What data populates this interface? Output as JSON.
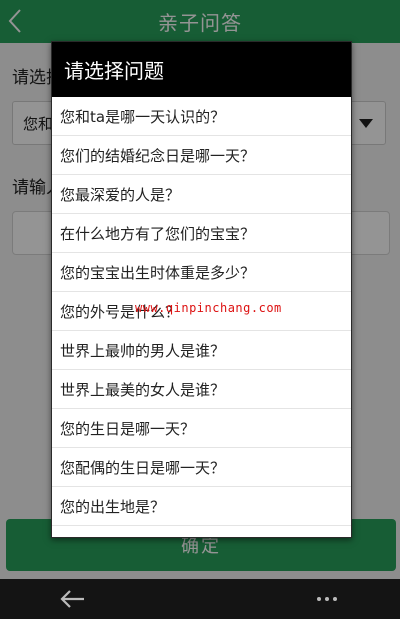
{
  "header": {
    "title": "亲子问答"
  },
  "form": {
    "label_question": "请选择您的问题：",
    "select_value": "您和ta是哪一天认识的？",
    "label_answer": "请输入答案：",
    "confirm_label": "确定"
  },
  "dialog": {
    "title": "请选择问题",
    "options": [
      "您和ta是哪一天认识的？",
      "您们的结婚纪念日是哪一天？",
      "您最深爱的人是？",
      "在什么地方有了您们的宝宝？",
      "您的宝宝出生时体重是多少？",
      "您的外号是什么？",
      "世界上最帅的男人是谁？",
      "世界上最美的女人是谁？",
      "您的生日是哪一天？",
      "您配偶的生日是哪一天？",
      "您的出生地是？"
    ]
  },
  "watermark": "www.qinpinchang.com",
  "icons": {
    "back": "chevron-left-icon",
    "nav_back": "arrow-left-icon",
    "nav_more": "more-dots-icon"
  },
  "colors": {
    "accent": "#28a05c",
    "dialog_title_bg": "#000000",
    "watermark": "#dd1111"
  }
}
